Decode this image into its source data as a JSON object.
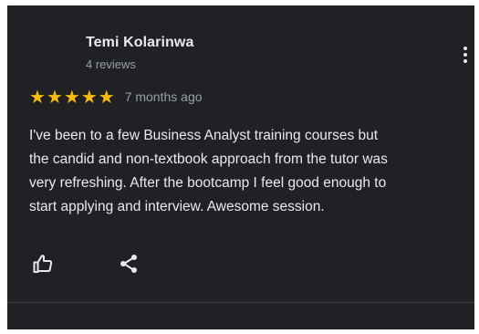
{
  "review": {
    "reviewer_name": "Temi Kolarinwa",
    "reviewer_meta": "4 reviews",
    "rating": 5,
    "rating_max": 5,
    "time_ago": "7 months ago",
    "text_lines": [
      "I've been to a few Business Analyst training courses but",
      "the candid and non-textbook approach from the tutor was",
      "very refreshing. After the bootcamp I feel good enough to",
      "start applying and interview. Awesome session."
    ],
    "icons": {
      "more": "more-vert-icon",
      "like": "thumbs-up-icon",
      "share": "share-icon",
      "star": "star-icon"
    }
  },
  "colors": {
    "background": "#202124",
    "star": "#fbbc04",
    "primary_text": "#e8eaed",
    "secondary_text": "#9aa0a6"
  }
}
